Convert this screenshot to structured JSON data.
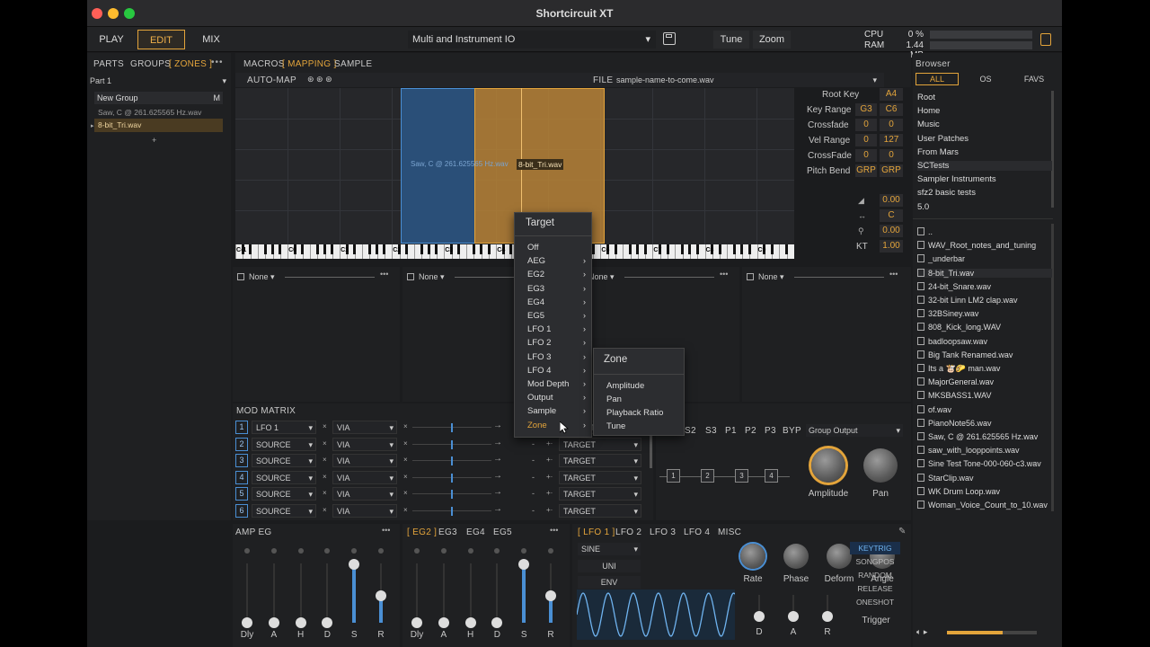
{
  "app": {
    "title": "Shortcircuit XT"
  },
  "topbar": {
    "modes": [
      "PLAY",
      "EDIT",
      "MIX"
    ],
    "preset": "Multi and Instrument IO",
    "tune": "Tune",
    "zoom": "Zoom",
    "cpu_label": "CPU",
    "cpu_value": "0 %",
    "ram_label": "RAM",
    "ram_value": "1.44 MB"
  },
  "left": {
    "tabs": [
      "PARTS",
      "GROUPS",
      "[ ZONES ]"
    ],
    "part": "Part 1",
    "group": "New Group",
    "group_badge": "M",
    "zones": [
      "Saw, C @ 261.625565 Hz.wav",
      "8-bit_Tri.wav"
    ],
    "add": "+"
  },
  "mapping": {
    "tabs": [
      "MACROS",
      "[ MAPPING ]",
      "SAMPLE"
    ],
    "automap": "AUTO-MAP",
    "file_label": "FILE",
    "file_name": "sample-name-to-come.wav",
    "zone_labels": [
      "Saw, C @ 261.625565 Hz.wav",
      "8-bit_Tri.wav"
    ],
    "octaves": [
      "C-1",
      "C0",
      "C1",
      "C2",
      "C3",
      "C4",
      "C5",
      "C6",
      "C7",
      "C8",
      "C9"
    ]
  },
  "zone_props": {
    "root_key_label": "Root Key",
    "root_key": "A4",
    "key_range_label": "Key Range",
    "key_lo": "G3",
    "key_hi": "C6",
    "crossfade_label": "Crossfade",
    "cf_lo": "0",
    "cf_hi": "0",
    "vel_range_label": "Vel Range",
    "vel_lo": "0",
    "vel_hi": "127",
    "crossfade2_label": "CrossFade",
    "cf2_lo": "0",
    "cf2_hi": "0",
    "pitch_bend_label": "Pitch Bend",
    "pb_lo": "GRP",
    "pb_hi": "GRP",
    "vol": "0.00",
    "pan": "C",
    "tune": "0.00",
    "kt_label": "KT",
    "kt": "1.00"
  },
  "processors": {
    "slots": [
      "None",
      "None",
      "None",
      "None"
    ]
  },
  "mod_matrix": {
    "title": "MOD MATRIX",
    "rows": [
      {
        "n": "1",
        "src": "LFO 1",
        "via": "VIA",
        "tgt": "TARGET"
      },
      {
        "n": "2",
        "src": "SOURCE",
        "via": "VIA",
        "tgt": "TARGET"
      },
      {
        "n": "3",
        "src": "SOURCE",
        "via": "VIA",
        "tgt": "TARGET"
      },
      {
        "n": "4",
        "src": "SOURCE",
        "via": "VIA",
        "tgt": "TARGET"
      },
      {
        "n": "5",
        "src": "SOURCE",
        "via": "VIA",
        "tgt": "TARGET"
      },
      {
        "n": "6",
        "src": "SOURCE",
        "via": "VIA",
        "tgt": "TARGET"
      }
    ],
    "dash": "-"
  },
  "routing": {
    "title_tail": "NG",
    "buttons": [
      "S2",
      "S3",
      "P1",
      "P2",
      "P3",
      "BYP"
    ],
    "output": "Group Output",
    "nodes": [
      "1",
      "2",
      "3",
      "4"
    ],
    "amplitude": "Amplitude",
    "pan": "Pan"
  },
  "target_menu": {
    "title": "Target",
    "items": [
      "Off",
      "AEG",
      "EG2",
      "EG3",
      "EG4",
      "EG5",
      "LFO 1",
      "LFO 2",
      "LFO 3",
      "LFO 4",
      "Mod Depth",
      "Output",
      "Sample",
      "Zone"
    ],
    "sub_title": "Zone",
    "sub_items": [
      "Amplitude",
      "Pan",
      "Playback Ratio",
      "Tune"
    ]
  },
  "amp_eg": {
    "title": "AMP EG",
    "labels": [
      "Dly",
      "A",
      "H",
      "D",
      "S",
      "R"
    ],
    "levels": [
      0.0,
      0.0,
      0.0,
      0.0,
      0.98,
      0.45
    ]
  },
  "eg2": {
    "tabs": [
      "[ EG2 ]",
      "EG3",
      "EG4",
      "EG5"
    ],
    "labels": [
      "Dly",
      "A",
      "H",
      "D",
      "S",
      "R"
    ],
    "levels": [
      0.0,
      0.0,
      0.0,
      0.0,
      0.98,
      0.45
    ]
  },
  "lfo": {
    "tabs": [
      "[ LFO 1 ]",
      "LFO 2",
      "LFO 3",
      "LFO 4",
      "MISC"
    ],
    "shape": "SINE",
    "uni": "UNI",
    "env": "ENV",
    "knobs": [
      "Rate",
      "Phase",
      "Deform",
      "Angle"
    ],
    "bottom": [
      "D",
      "A",
      "R"
    ],
    "trigger": [
      "KEYTRIG",
      "SONGPOS",
      "RANDOM",
      "RELEASE",
      "ONESHOT"
    ],
    "trigger_label": "Trigger"
  },
  "browser": {
    "title": "Browser",
    "tabs": [
      "ALL",
      "OS",
      "FAVS"
    ],
    "locations": [
      "Root",
      "Home",
      "Music",
      "User Patches",
      "From Mars",
      "SCTests",
      "Sampler Instruments",
      "sfz2 basic tests",
      "5.0"
    ],
    "files": [
      "..",
      "WAV_Root_notes_and_tuning",
      "_underbar",
      "8-bit_Tri.wav",
      "24-bit_Snare.wav",
      "32-bit Linn LM2 clap.wav",
      "32BSiney.wav",
      "808_Kick_long.WAV",
      "badloopsaw.wav",
      "Big Tank Renamed.wav",
      "Its a 🐮🌮 man.wav",
      "MajorGeneral.wav",
      "MKSBASS1.WAV",
      "of.wav",
      "PianoNote56.wav",
      "Saw, C @ 261.625565 Hz.wav",
      "saw_with_looppoints.wav",
      "Sine Test Tone-000-060-c3.wav",
      "StarClip.wav",
      "WK Drum Loop.wav",
      "Woman_Voice_Count_to_10.wav"
    ]
  },
  "colors": {
    "accent": "#e3a43b",
    "blue": "#4a8fd4",
    "panel": "#1f2022"
  }
}
